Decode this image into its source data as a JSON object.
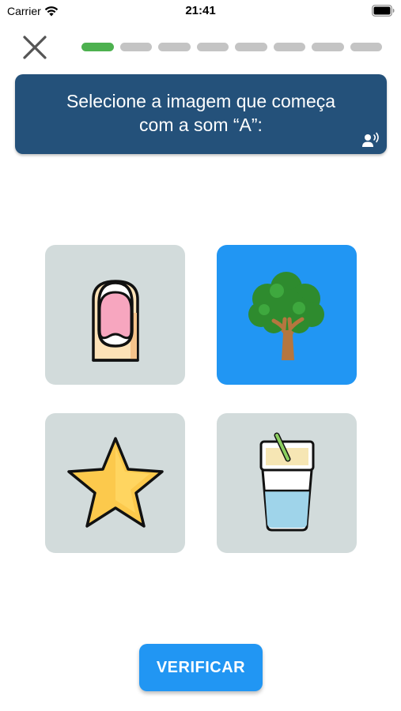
{
  "status_bar": {
    "carrier": "Carrier",
    "time": "21:41",
    "icons": [
      "wifi-icon",
      "battery-icon"
    ]
  },
  "header": {
    "close_icon": "close-icon",
    "progress": {
      "total_steps": 8,
      "completed_steps": 1,
      "done_color": "#4db14f",
      "pending_color": "#c4c4c4"
    }
  },
  "prompt": {
    "line1": "Selecione a imagem que começa",
    "line2": "com a som “A”:",
    "audio_icon": "speaker-person-icon",
    "background": "#24517a"
  },
  "options": [
    {
      "id": "nail",
      "icon": "fingernail-icon",
      "selected": false
    },
    {
      "id": "tree",
      "icon": "tree-icon",
      "selected": true
    },
    {
      "id": "star",
      "icon": "star-icon",
      "selected": false
    },
    {
      "id": "drink",
      "icon": "drink-cup-icon",
      "selected": false
    }
  ],
  "colors": {
    "card_default": "#d2dbdb",
    "card_selected": "#2196f3",
    "accent": "#2196f3"
  },
  "verify_button": {
    "label": "VERIFICAR"
  }
}
